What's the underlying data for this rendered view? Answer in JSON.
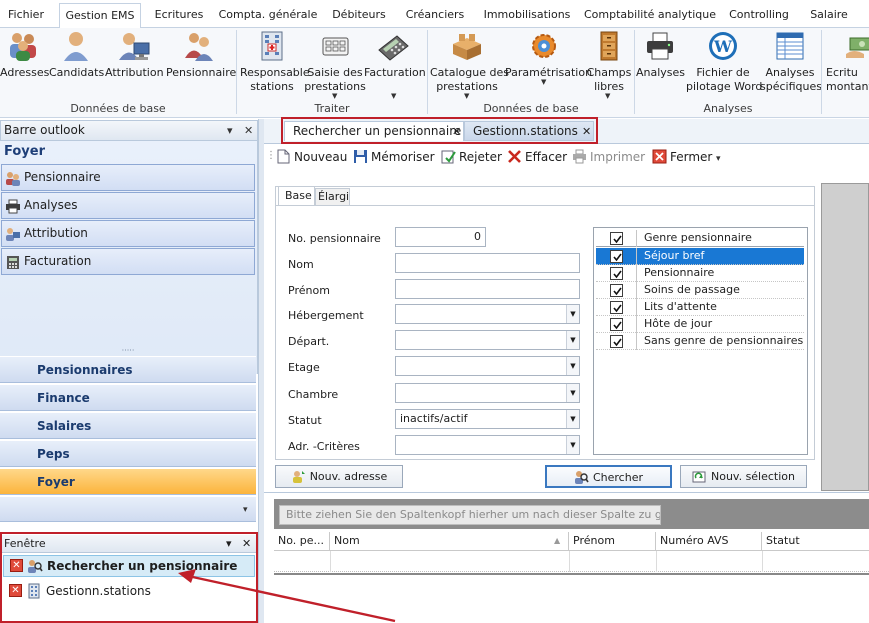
{
  "menu_tabs": [
    "Fichier",
    "Gestion EMS",
    "Ecritures",
    "Compta. générale",
    "Débiteurs",
    "Créanciers",
    "Immobilisations",
    "Comptabilité analytique",
    "Controlling",
    "Salaire"
  ],
  "ribbon": {
    "buttons": [
      {
        "id": "adresses",
        "label": "Adresses"
      },
      {
        "id": "candidats",
        "label": "Candidats"
      },
      {
        "id": "attribution",
        "label": "Attribution"
      },
      {
        "id": "pensionnaire",
        "label": "Pensionnaire"
      },
      {
        "id": "responsable",
        "label": "Responsable\nstations"
      },
      {
        "id": "saisie",
        "label": "Saisie des\nprestations"
      },
      {
        "id": "facturation",
        "label": "Facturation"
      },
      {
        "id": "catalogue",
        "label": "Catalogue des\nprestations"
      },
      {
        "id": "parametrisation",
        "label": "Paramétrisation"
      },
      {
        "id": "champs",
        "label": "Champs\nlibres"
      },
      {
        "id": "analyses",
        "label": "Analyses"
      },
      {
        "id": "fichier_word",
        "label": "Fichier de\npilotage Word"
      },
      {
        "id": "analyses_spec",
        "label": "Analyses\nspécifiques"
      },
      {
        "id": "ecritures_montant",
        "label": "Ecritu\nmontant"
      }
    ],
    "groups": [
      "Données de base",
      "Traiter",
      "Données de base",
      "Analyses"
    ]
  },
  "outlook_bar": {
    "title": "Barre outlook",
    "section_title": "Foyer",
    "items": [
      "Pensionnaire",
      "Analyses",
      "Attribution",
      "Facturation"
    ],
    "groups": [
      "Pensionnaires",
      "Finance",
      "Salaires",
      "Peps",
      "Foyer"
    ]
  },
  "window_panel": {
    "title": "Fenêtre",
    "items": [
      "Rechercher un pensionnaire",
      "Gestionn.stations"
    ]
  },
  "doc_tabs": [
    "Rechercher un pensionnaire",
    "Gestionn.stations"
  ],
  "toolbar": {
    "nouveau": "Nouveau",
    "memoriser": "Mémoriser",
    "rejeter": "Rejeter",
    "effacer": "Effacer",
    "imprimer": "Imprimer",
    "fermer": "Fermer"
  },
  "form_tabs": [
    "Base",
    "Élargi"
  ],
  "form": {
    "no_pensionnaire": {
      "label": "No. pensionnaire",
      "value": "0"
    },
    "nom": {
      "label": "Nom",
      "value": ""
    },
    "prenom": {
      "label": "Prénom",
      "value": ""
    },
    "hebergement": {
      "label": "Hébergement",
      "value": ""
    },
    "depart": {
      "label": "Départ.",
      "value": ""
    },
    "etage": {
      "label": "Etage",
      "value": ""
    },
    "chambre": {
      "label": "Chambre",
      "value": ""
    },
    "statut": {
      "label": "Statut",
      "value": "inactifs/actif"
    },
    "adr_criteres": {
      "label": "Adr. -Critères",
      "value": ""
    }
  },
  "check_list": {
    "header": "Genre pensionnaire",
    "items": [
      "Séjour bref",
      "Pensionnaire",
      "Soins de passage",
      "Lits d'attente",
      "Hôte de jour",
      "Sans genre de pensionnaires"
    ]
  },
  "buttons": {
    "nouv_adresse": "Nouv. adresse",
    "chercher": "Chercher",
    "nouv_selection": "Nouv. sélection"
  },
  "grid": {
    "group_hint": "Bitte ziehen Sie den Spaltenkopf hierher um nach dieser Spalte zu gruppieren.",
    "columns": [
      "No. pe...",
      "Nom",
      "Prénom",
      "Numéro AVS",
      "Statut"
    ]
  },
  "colors": {
    "accent_red": "#c0202a",
    "selection_blue": "#1978d4",
    "active_orange": "#fbb43c"
  }
}
